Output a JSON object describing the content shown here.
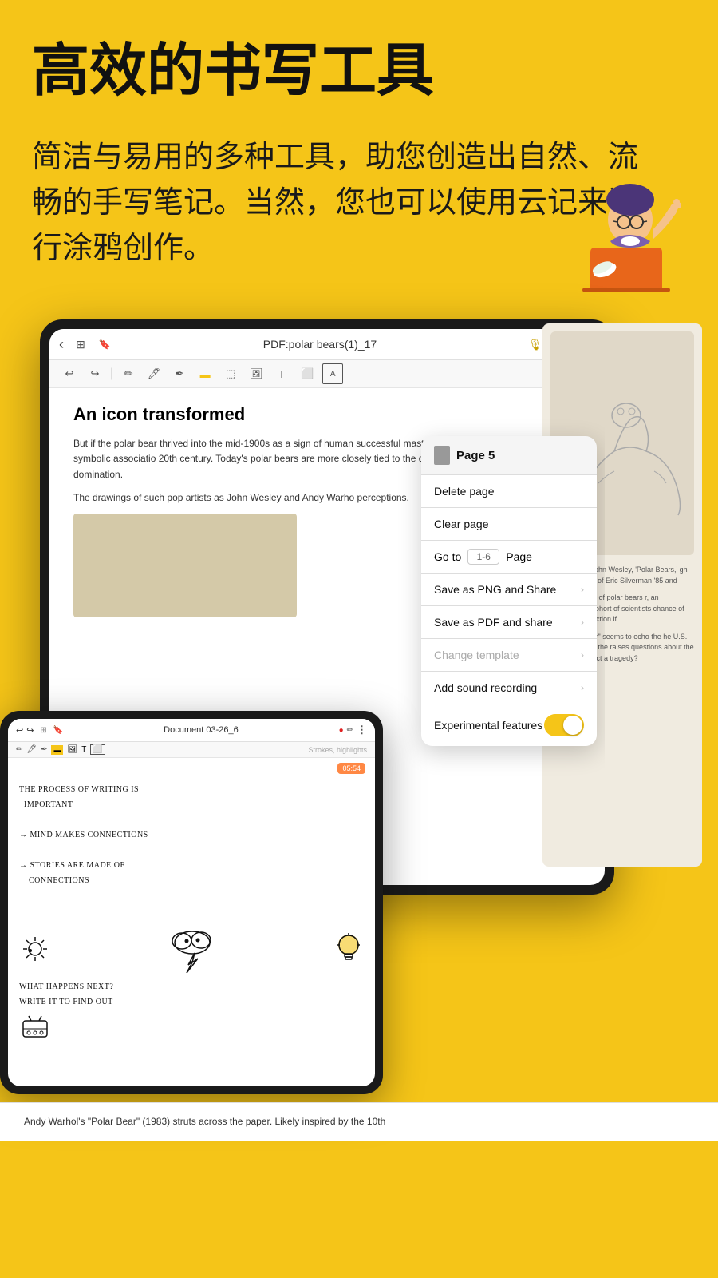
{
  "page": {
    "background_color": "#F5C518",
    "main_title": "高效的书写工具",
    "subtitle": "简洁与易用的多种工具，助您创造出自然、流畅的手写笔记。当然，您也可以使用云记来进行涂鸦创作。"
  },
  "main_tablet": {
    "doc_name": "PDF:polar bears(1)_17",
    "doc_title": "An icon transformed",
    "doc_body_1": "But if the polar bear thrived into the mid-1900s as a sign of human successful mastery of antagonistic forces, this symbolic associatio 20th century. Today's polar bears are more closely tied to the dem belief in conquest and domination.",
    "doc_body_2": "The drawings of such pop artists as John Wesley and Andy Warho perceptions."
  },
  "context_menu": {
    "page_label": "Page 5",
    "items": [
      {
        "label": "Delete page",
        "disabled": false,
        "has_arrow": false
      },
      {
        "label": "Clear page",
        "disabled": false,
        "has_arrow": false
      },
      {
        "label": "Go to",
        "goto": true,
        "placeholder": "1-6",
        "page_label": "Page",
        "has_arrow": false
      },
      {
        "label": "Save as PNG and Share",
        "disabled": false,
        "has_arrow": true
      },
      {
        "label": "Save as PDF and share",
        "disabled": false,
        "has_arrow": true
      },
      {
        "label": "Change template",
        "disabled": true,
        "has_arrow": true
      },
      {
        "label": "Add sound recording",
        "disabled": false,
        "has_arrow": true
      },
      {
        "label": "Experimental features",
        "disabled": false,
        "toggle": true
      }
    ]
  },
  "small_tablet": {
    "doc_name": "Document 03-26_6",
    "timer": "05:54",
    "strokes_label": "Strokes, highlights",
    "handwriting": [
      "The Process of writing is",
      "  important",
      "",
      "→ Mind makes connections",
      "",
      "→ Stories are made of",
      "    connections",
      "",
      "- - - - - - -",
      "",
      "What happens next?",
      "Write it to find out"
    ]
  },
  "right_panel": {
    "caption_1": "mber mood. John Wesley, 'Polar Bears,' gh the generosity of Eric Silverman '85 and",
    "caption_2": "rtwined bodies of polar bears r, an international cohort of scientists chance of surviving extinction if",
    "caption_3": "reat white bear\" seems to echo the he U.S. Department of the raises questions about the fate of the n fact a tragedy?",
    "department_text": "Department of the"
  },
  "bottom_strip": {
    "text": "Andy Warhol's \"Polar Bear\" (1983) struts across the paper. Likely inspired by the 10th"
  },
  "toolbar": {
    "back_icon": "‹",
    "title": "PDF:polar bears(1)_17 ▾",
    "mic_icon": "🎙",
    "pen_icon": "✏",
    "more_icon": "⋮",
    "undo_icon": "↩",
    "redo_icon": "↪",
    "draw_tools": [
      "✏",
      "🖊",
      "✒",
      "◻",
      "⬚",
      "⬜",
      "A"
    ]
  },
  "icons": {
    "grid_icon": "⊞",
    "bookmark_icon": "🔖",
    "chevron_right": "›",
    "page_icon": "📄"
  }
}
